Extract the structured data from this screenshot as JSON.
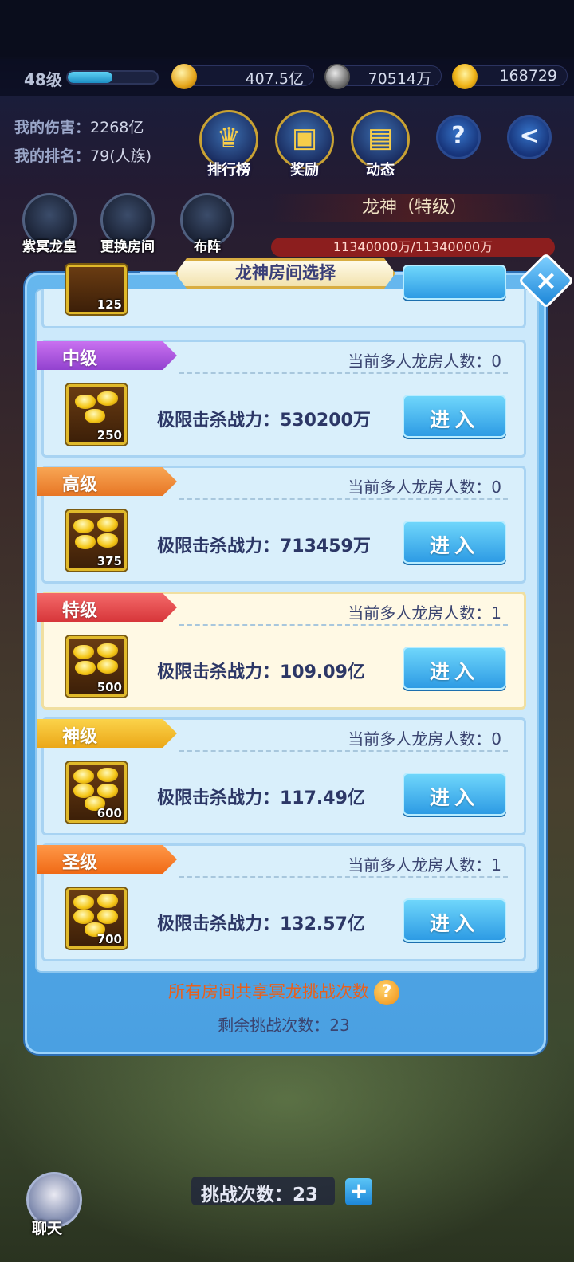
{
  "topbar": {
    "level": "48级",
    "level_progress": 0.5,
    "gold": "407.5亿",
    "coins": "70514万",
    "ingots": "168729"
  },
  "stats": {
    "damage_label": "我的伤害：",
    "damage_value": "2268亿",
    "rank_label": "我的排名：",
    "rank_value": "79(人族)"
  },
  "menu": {
    "ranking": "排行榜",
    "rewards": "奖励",
    "news": "动态",
    "help": "?",
    "back": "<"
  },
  "left_menu": {
    "boss": "紫冥龙皇",
    "change_room": "更换房间",
    "formation": "布阵"
  },
  "boss": {
    "title": "龙神（特级）",
    "hp": "11340000万/11340000万"
  },
  "modal": {
    "title": "龙神房间选择",
    "close": "×",
    "partial_item_count": "125",
    "rooms": [
      {
        "tier": "中级",
        "count_text": "当前多人龙房人数：0",
        "power_text": "极限击杀战力：530200万",
        "item_count": "250",
        "enter": "进入"
      },
      {
        "tier": "高级",
        "count_text": "当前多人龙房人数：0",
        "power_text": "极限击杀战力：713459万",
        "item_count": "375",
        "enter": "进入"
      },
      {
        "tier": "特级",
        "count_text": "当前多人龙房人数：1",
        "power_text": "极限击杀战力：109.09亿",
        "item_count": "500",
        "enter": "进入"
      },
      {
        "tier": "神级",
        "count_text": "当前多人龙房人数：0",
        "power_text": "极限击杀战力：117.49亿",
        "item_count": "600",
        "enter": "进入"
      },
      {
        "tier": "圣级",
        "count_text": "当前多人龙房人数：1",
        "power_text": "极限击杀战力：132.57亿",
        "item_count": "700",
        "enter": "进入"
      }
    ],
    "shared_note": "所有房间共享冥龙挑战次数",
    "help_icon": "?",
    "remaining": "剩余挑战次数：23"
  },
  "hud": {
    "chat": "聊天",
    "challenge_count": "挑战次数：23",
    "plus": "+"
  }
}
